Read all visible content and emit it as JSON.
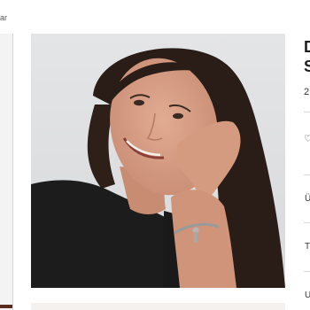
{
  "breadcrumb": {
    "text": "ar"
  },
  "product": {
    "title_line1": "D",
    "title_line2": "S",
    "price": "2",
    "photo_alt": "Model wearing charm bracelet"
  },
  "actions": {
    "wishlist_icon": "heart-outline-icon"
  },
  "accordion": {
    "items": [
      {
        "label": "Ü"
      },
      {
        "label": "T"
      },
      {
        "label": "U"
      }
    ]
  },
  "colors": {
    "accent": "#5a2a1f",
    "photo_background": "#e2e3e5"
  }
}
